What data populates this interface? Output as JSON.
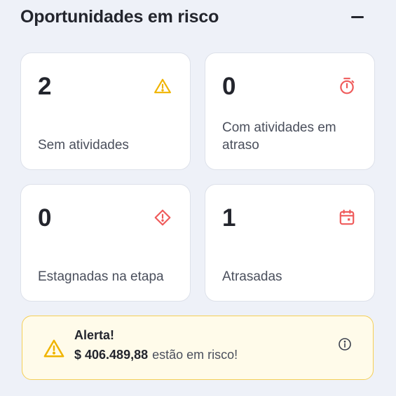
{
  "header": {
    "title": "Oportunidades em risco",
    "collapse_icon": "minus-icon"
  },
  "cards": [
    {
      "value": "2",
      "label": "Sem atividades",
      "icon": "warning-triangle-icon",
      "color": "#f0b400"
    },
    {
      "value": "0",
      "label": "Com atividades em atraso",
      "icon": "stopwatch-icon",
      "color": "#ef5a5a"
    },
    {
      "value": "0",
      "label": "Estagnadas na etapa",
      "icon": "alert-diamond-icon",
      "color": "#ef5a5a"
    },
    {
      "value": "1",
      "label": "Atrasadas",
      "icon": "calendar-icon",
      "color": "#ef5a5a"
    }
  ],
  "alert": {
    "title": "Alerta!",
    "amount": "$ 406.489,88",
    "message": "estão em risco!",
    "icon": "warning-triangle-icon",
    "info_icon": "info-icon",
    "border_color": "#f5cf57",
    "background": "#fffbea"
  }
}
